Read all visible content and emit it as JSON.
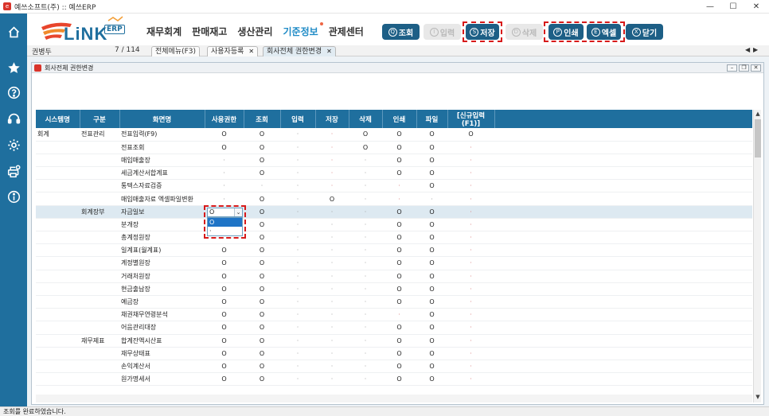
{
  "window": {
    "title": "예쓰소프트(주) :: 예쓰ERP",
    "minimize": "—",
    "maximize": "☐",
    "close": "✕"
  },
  "colors": {
    "primary": "#1f6f9e",
    "toolbar_button": "#1d5f86",
    "highlight": "#d71a1a",
    "active_menu": "#1f8bc6"
  },
  "sidebar": {
    "items": [
      {
        "icon": "home-icon"
      },
      {
        "icon": "star-icon"
      },
      {
        "icon": "help-icon"
      },
      {
        "icon": "headset-icon"
      },
      {
        "icon": "gear-icon"
      },
      {
        "icon": "printer-settings-icon"
      },
      {
        "icon": "info-icon"
      }
    ]
  },
  "logo": {
    "text": "LiNK",
    "badge": "ERP"
  },
  "menu": [
    {
      "label": "재무회계",
      "active": false
    },
    {
      "label": "판매재고",
      "active": false
    },
    {
      "label": "생산관리",
      "active": false
    },
    {
      "label": "기준정보",
      "active": true
    },
    {
      "label": "관제센터",
      "active": false
    }
  ],
  "toolbar": {
    "query": {
      "key": "Q",
      "label": "조회"
    },
    "input": {
      "key": "I",
      "label": "입력"
    },
    "save": {
      "key": "S",
      "label": "저장"
    },
    "delete": {
      "key": "D",
      "label": "삭제"
    },
    "print": {
      "key": "P",
      "label": "인쇄"
    },
    "excel": {
      "key": "E",
      "label": "엑셀"
    },
    "close": {
      "key": "X",
      "label": "닫기"
    }
  },
  "tabsbar": {
    "user": "권병두",
    "count": "7 / 114",
    "prev": "◀",
    "next": "▶",
    "tabs": [
      {
        "label": "전체메뉴(F3)",
        "close": ""
      },
      {
        "label": "사용자등록",
        "close": "✕"
      },
      {
        "label": "회사전체 권한변경",
        "close": "✕"
      }
    ]
  },
  "inner_window": {
    "title": "회사전체 권한변경",
    "min": "–",
    "restore": "❐",
    "close": "✕"
  },
  "grid": {
    "columns": [
      "시스템명",
      "구분",
      "화면명",
      "사용권한",
      "조회",
      "입력",
      "저장",
      "삭제",
      "인쇄",
      "파일",
      "[신규입력(F1)]"
    ],
    "rows": [
      [
        "회계",
        "전표관리",
        "전표입력(F9)",
        "O",
        "O",
        "·",
        "·",
        "O",
        "O",
        "O",
        "O"
      ],
      [
        "",
        "",
        "전표조회",
        "O",
        "O",
        "·",
        "·",
        "O",
        "O",
        "O",
        "·"
      ],
      [
        "",
        "",
        "매입매출장",
        "·",
        "O",
        "·",
        "·",
        "·",
        "O",
        "O",
        "·"
      ],
      [
        "",
        "",
        "세금계산서합계표",
        "·",
        "O",
        "·",
        "·",
        "·",
        "O",
        "O",
        "·"
      ],
      [
        "",
        "",
        "통텍스자료검증",
        "·",
        "·",
        "·",
        "·",
        "·",
        "·",
        "O",
        "·"
      ],
      [
        "",
        "",
        "매입매출자료 엑셀파일변환",
        "·",
        "O",
        "·",
        "O",
        "·",
        "·",
        "·",
        "·"
      ],
      [
        "",
        "회계장부",
        "자금일보",
        "O",
        "O",
        "·",
        "·",
        "·",
        "O",
        "O",
        "·"
      ],
      [
        "",
        "",
        "분개장",
        "",
        "O",
        "·",
        "·",
        "·",
        "O",
        "O",
        "·"
      ],
      [
        "",
        "",
        "총계정원장",
        "",
        "O",
        "·",
        "·",
        "·",
        "O",
        "O",
        "·"
      ],
      [
        "",
        "",
        "일계표(월계표)",
        "O",
        "O",
        "·",
        "·",
        "·",
        "O",
        "O",
        "·"
      ],
      [
        "",
        "",
        "계정별원장",
        "O",
        "O",
        "·",
        "·",
        "·",
        "O",
        "O",
        "·"
      ],
      [
        "",
        "",
        "거래처원장",
        "O",
        "O",
        "·",
        "·",
        "·",
        "O",
        "O",
        "·"
      ],
      [
        "",
        "",
        "현금출납장",
        "O",
        "O",
        "·",
        "·",
        "·",
        "O",
        "O",
        "·"
      ],
      [
        "",
        "",
        "예금장",
        "O",
        "O",
        "·",
        "·",
        "·",
        "O",
        "O",
        "·"
      ],
      [
        "",
        "",
        "채권채무연령분석",
        "O",
        "O",
        "·",
        "·",
        "·",
        "·",
        "O",
        "·"
      ],
      [
        "",
        "",
        "어음관리대장",
        "O",
        "O",
        "·",
        "·",
        "·",
        "O",
        "O",
        "·"
      ],
      [
        "",
        "재무제표",
        "합계잔액시산표",
        "O",
        "O",
        "·",
        "·",
        "·",
        "O",
        "O",
        "·"
      ],
      [
        "",
        "",
        "재무상태표",
        "O",
        "O",
        "·",
        "·",
        "·",
        "O",
        "O",
        "·"
      ],
      [
        "",
        "",
        "손익계산서",
        "O",
        "O",
        "·",
        "·",
        "·",
        "O",
        "O",
        "·"
      ],
      [
        "",
        "",
        "원가명세서",
        "O",
        "O",
        "·",
        "·",
        "·",
        "O",
        "O",
        "·"
      ]
    ]
  },
  "dropdown": {
    "value": "O",
    "arrow": "⌄",
    "options": [
      "O",
      "·"
    ]
  },
  "scroll": {
    "up": "▲",
    "down": "▼"
  },
  "status": "조회를 완료하였습니다."
}
